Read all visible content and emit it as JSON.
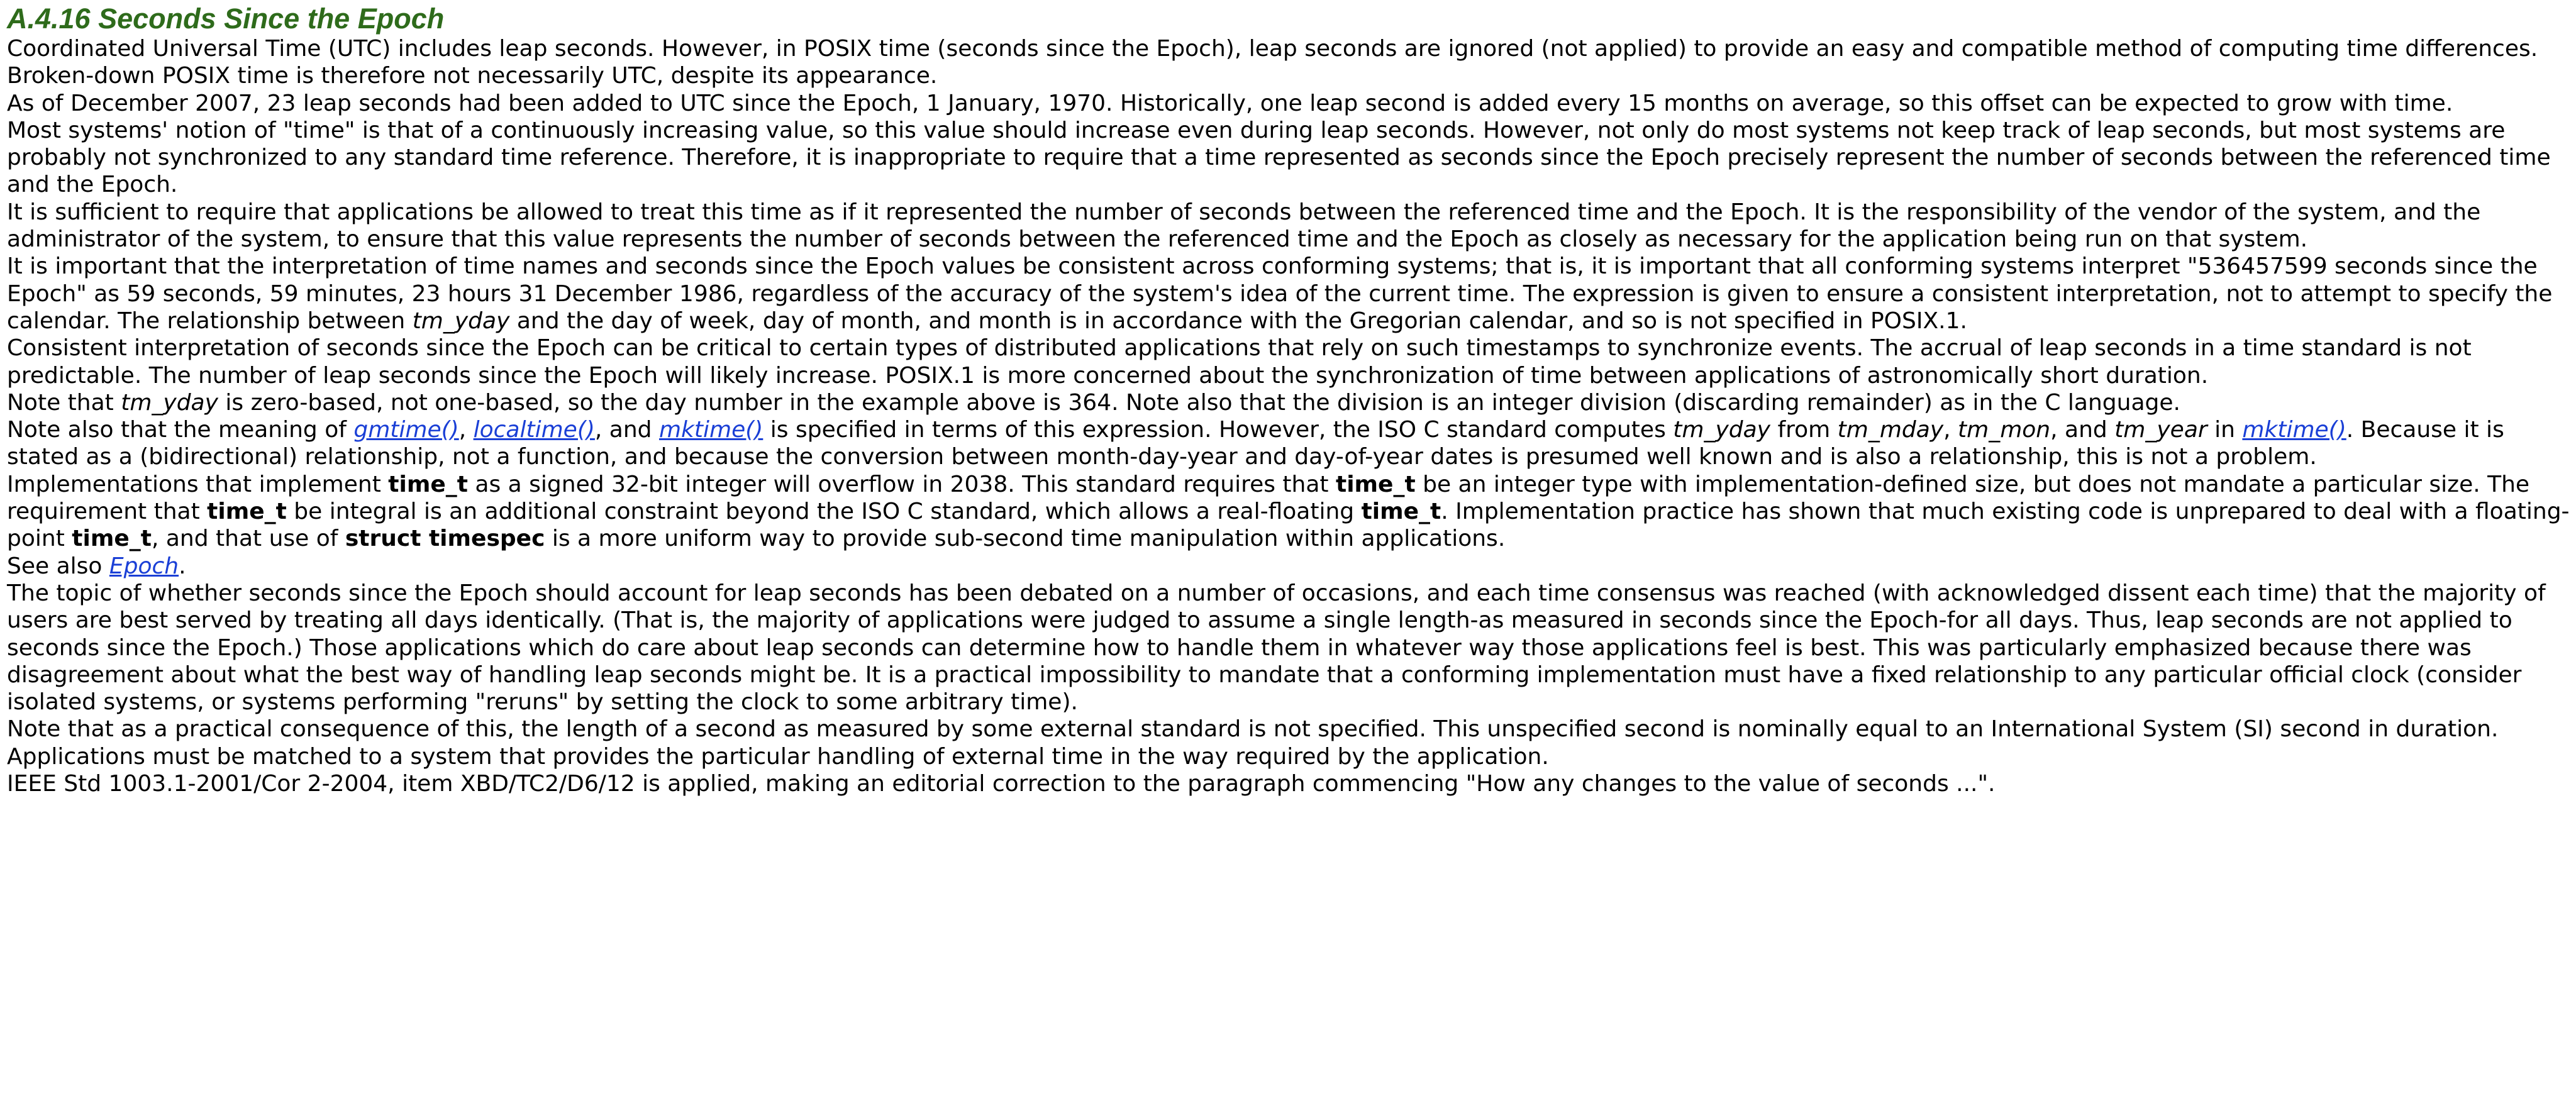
{
  "heading": "A.4.16 Seconds Since the Epoch",
  "p1": "Coordinated Universal Time (UTC) includes leap seconds. However, in POSIX time (seconds since the Epoch), leap seconds are ignored (not applied) to provide an easy and compatible method of computing time differences. Broken-down POSIX time is therefore not necessarily UTC, despite its appearance.",
  "p2": "As of December 2007, 23 leap seconds had been added to UTC since the Epoch, 1 January, 1970. Historically, one leap second is added every 15 months on average, so this offset can be expected to grow with time.",
  "p3": "Most systems' notion of \"time\" is that of a continuously increasing value, so this value should increase even during leap seconds. However, not only do most systems not keep track of leap seconds, but most systems are probably not synchronized to any standard time reference. Therefore, it is inappropriate to require that a time represented as seconds since the Epoch precisely represent the number of seconds between the referenced time and the Epoch.",
  "p4": "It is sufficient to require that applications be allowed to treat this time as if it represented the number of seconds between the referenced time and the Epoch. It is the responsibility of the vendor of the system, and the administrator of the system, to ensure that this value represents the number of seconds between the referenced time and the Epoch as closely as necessary for the application being run on that system.",
  "p5": {
    "t1": "It is important that the interpretation of time names and seconds since the Epoch values be consistent across conforming systems; that is, it is important that all conforming systems interpret \"536457599 seconds since the Epoch\" as 59 seconds, 59 minutes, 23 hours 31 December 1986, regardless of the accuracy of the system's idea of the current time. The expression is given to ensure a consistent interpretation, not to attempt to specify the calendar. The relationship between ",
    "e1": "tm_yday",
    "t2": " and the day of week, day of month, and month is in accordance with the Gregorian calendar, and so is not specified in POSIX.1."
  },
  "p6": "Consistent interpretation of seconds since the Epoch can be critical to certain types of distributed applications that rely on such timestamps to synchronize events. The accrual of leap seconds in a time standard is not predictable. The number of leap seconds since the Epoch will likely increase. POSIX.1 is more concerned about the synchronization of time between applications of astronomically short duration.",
  "p7": {
    "t1": "Note that ",
    "e1": "tm_yday",
    "t2": " is zero-based, not one-based, so the day number in the example above is 364. Note also that the division is an integer division (discarding remainder) as in the C language."
  },
  "p8": {
    "t1": "Note also that the meaning of ",
    "l1": "gmtime()",
    "t2": ", ",
    "l2": "localtime()",
    "t3": ", and ",
    "l3": "mktime()",
    "t4": " is specified in terms of this expression. However, the ISO C standard computes ",
    "e1": "tm_yday",
    "t5": " from ",
    "e2": "tm_mday",
    "t6": ", ",
    "e3": "tm_mon",
    "t7": ", and ",
    "e4": "tm_year",
    "t8": " in ",
    "l4": "mktime()",
    "t9": ". Because it is stated as a (bidirectional) relationship, not a function, and because the conversion between month-day-year and day-of-year dates is presumed well known and is also a relationship, this is not a problem."
  },
  "p9": {
    "t1": "Implementations that implement ",
    "b1": "time_t",
    "t2": " as a signed 32-bit integer will overflow in 2038. This standard requires that ",
    "b2": "time_t",
    "t3": " be an integer type with implementation-defined size, but does not mandate a particular size. The requirement that ",
    "b3": "time_t",
    "t4": " be integral is an additional constraint beyond the ISO C standard, which allows a real-floating ",
    "b4": "time_t",
    "t5": ". Implementation practice has shown that much existing code is unprepared to deal with a floating-point ",
    "b5": "time_t",
    "t6": ", and that use of ",
    "b6": "struct timespec",
    "t7": " is a more uniform way to provide sub-second time manipulation within applications."
  },
  "p10": {
    "t1": "See also ",
    "l1": "Epoch",
    "t2": "."
  },
  "p11": "The topic of whether seconds since the Epoch should account for leap seconds has been debated on a number of occasions, and each time consensus was reached (with acknowledged dissent each time) that the majority of users are best served by treating all days identically. (That is, the majority of applications were judged to assume a single length-as measured in seconds since the Epoch-for all days. Thus, leap seconds are not applied to seconds since the Epoch.) Those applications which do care about leap seconds can determine how to handle them in whatever way those applications feel is best. This was particularly emphasized because there was disagreement about what the best way of handling leap seconds might be. It is a practical impossibility to mandate that a conforming implementation must have a fixed relationship to any particular official clock (consider isolated systems, or systems performing \"reruns\" by setting the clock to some arbitrary time).",
  "p12": "Note that as a practical consequence of this, the length of a second as measured by some external standard is not specified. This unspecified second is nominally equal to an International System (SI) second in duration. Applications must be matched to a system that provides the particular handling of external time in the way required by the application.",
  "p13": "IEEE Std 1003.1-2001/Cor 2-2004, item XBD/TC2/D6/12 is applied, making an editorial correction to the paragraph commencing \"How any changes to the value of seconds ...\"."
}
